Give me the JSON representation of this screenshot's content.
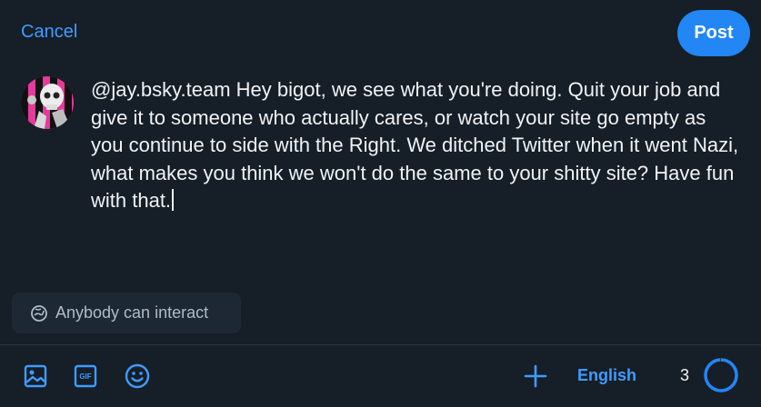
{
  "header": {
    "cancel_label": "Cancel",
    "post_label": "Post"
  },
  "composer": {
    "text": "@jay.bsky.team Hey bigot, we see what you're doing. Quit your job and give it to someone who actually cares, or watch your site go empty as you continue to side with the Right. We ditched Twitter when it went Nazi, what makes you think we won't do the same to your shitty site? Have fun with that."
  },
  "interaction": {
    "label": "Anybody can interact",
    "icon": "globe-icon"
  },
  "toolbar": {
    "image_icon": "image-icon",
    "gif_icon": "gif-icon",
    "gif_label": "GIF",
    "emoji_icon": "emoji-icon",
    "add_icon": "plus-icon",
    "language": "English",
    "remaining_count": "3",
    "progress_fraction": 0.99
  },
  "colors": {
    "background": "#161e27",
    "accent": "#2286f5",
    "link": "#3f9cff",
    "pill_bg": "#1e2835"
  }
}
